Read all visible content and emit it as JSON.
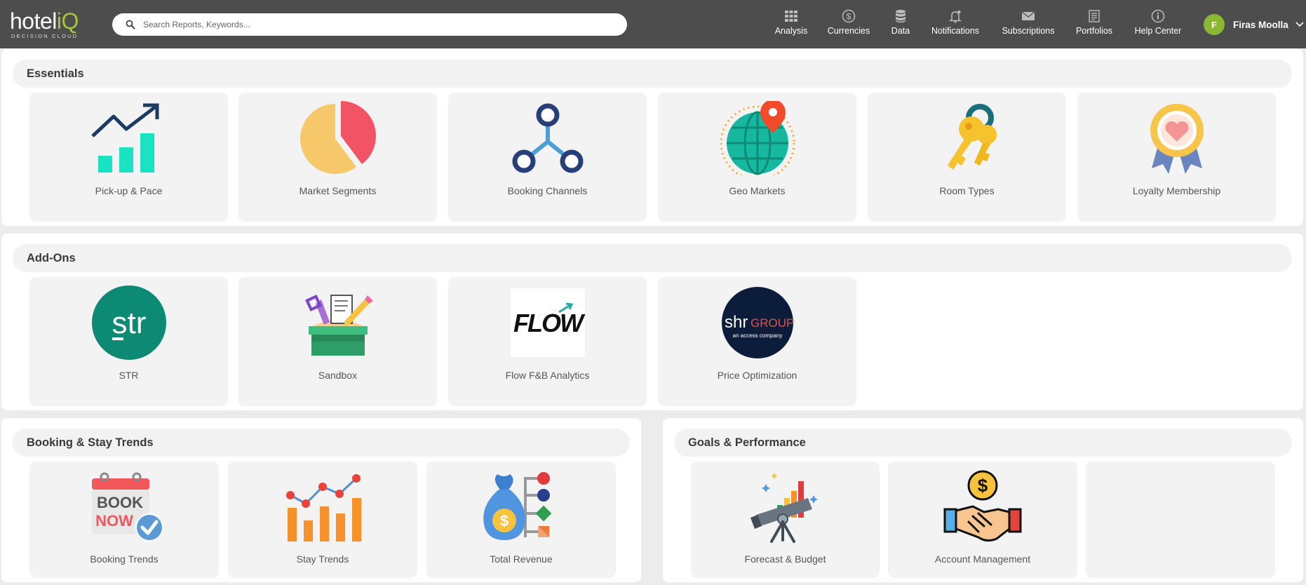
{
  "brand": {
    "name_main": "hotel",
    "name_accent": "iQ",
    "tagline": "DECISION CLOUD"
  },
  "search": {
    "placeholder": "Search Reports, Keywords..."
  },
  "nav": [
    {
      "label": "Analysis",
      "icon": "grid-icon"
    },
    {
      "label": "Currencies",
      "icon": "dollar-circle-icon"
    },
    {
      "label": "Data",
      "icon": "database-icon"
    },
    {
      "label": "Notifications",
      "icon": "bell-icon"
    },
    {
      "label": "Subscriptions",
      "icon": "envelope-icon"
    },
    {
      "label": "Portfolios",
      "icon": "document-list-icon"
    },
    {
      "label": "Help Center",
      "icon": "info-circle-icon"
    }
  ],
  "user": {
    "initial": "F",
    "name": "Firas Moolla"
  },
  "sections": {
    "essentials": {
      "title": "Essentials",
      "items": [
        {
          "label": "Pick-up & Pace",
          "icon": "growth-chart-icon"
        },
        {
          "label": "Market Segments",
          "icon": "pie-chart-icon"
        },
        {
          "label": "Booking Channels",
          "icon": "network-nodes-icon"
        },
        {
          "label": "Geo Markets",
          "icon": "globe-pin-icon"
        },
        {
          "label": "Room Types",
          "icon": "keys-icon"
        },
        {
          "label": "Loyalty Membership",
          "icon": "award-badge-icon"
        }
      ]
    },
    "addons": {
      "title": "Add-Ons",
      "items": [
        {
          "label": "STR",
          "icon": "str-logo-icon",
          "logo_text": "str"
        },
        {
          "label": "Sandbox",
          "icon": "sandbox-icon"
        },
        {
          "label": "Flow F&B Analytics",
          "icon": "flow-logo-icon",
          "logo_text": "FLOW"
        },
        {
          "label": "Price Optimization",
          "icon": "shr-group-logo-icon",
          "logo_text_main": "shr",
          "logo_text_group": "GROUP",
          "logo_text_sub": "an access company"
        }
      ]
    },
    "booking_stay": {
      "title": "Booking & Stay Trends",
      "items": [
        {
          "label": "Booking Trends",
          "icon": "booking-calendar-icon",
          "art_line1": "BOOK",
          "art_line2": "NOW"
        },
        {
          "label": "Stay Trends",
          "icon": "bar-line-chart-icon"
        },
        {
          "label": "Total Revenue",
          "icon": "money-bag-icon"
        }
      ]
    },
    "goals": {
      "title": "Goals & Performance",
      "items": [
        {
          "label": "Forecast & Budget",
          "icon": "telescope-chart-icon"
        },
        {
          "label": "Account Management",
          "icon": "handshake-dollar-icon"
        },
        {
          "label": "",
          "icon": ""
        }
      ]
    }
  },
  "colors": {
    "topbar": "#4d4d4d",
    "accent": "#a4c639",
    "card": "#f3f3f3"
  }
}
